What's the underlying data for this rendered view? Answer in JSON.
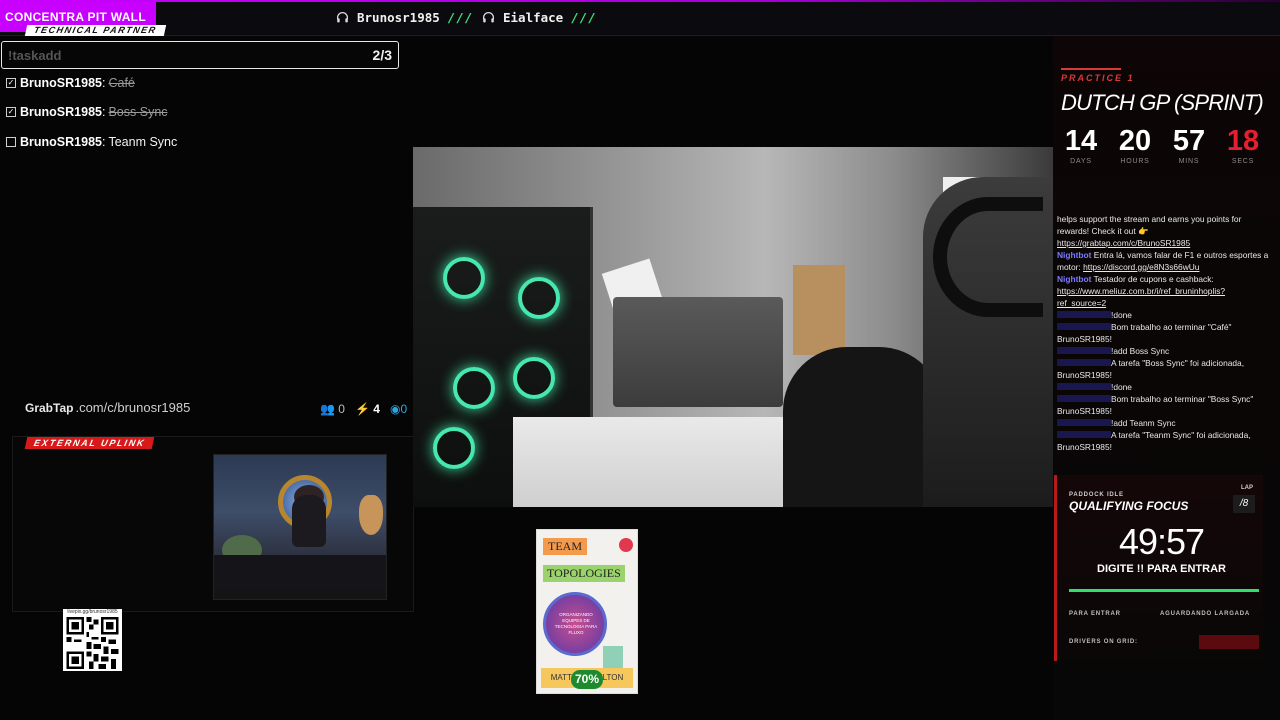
{
  "topbar": {
    "brand": "CONCENTRA PIT WALL",
    "team_1": "Brunosr1985",
    "team_2": "Eialface",
    "divider": "///"
  },
  "tasks": {
    "partner_tag": "TECHNICAL PARTNER",
    "command": "!taskadd",
    "count": "2/3",
    "items": [
      {
        "user": "BrunoSR1985",
        "text": "Café",
        "done": true
      },
      {
        "user": "BrunoSR1985",
        "text": "Boss Sync",
        "done": true
      },
      {
        "user": "BrunoSR1985",
        "text": "Teanm Sync",
        "done": false
      }
    ],
    "separator": ":"
  },
  "grabtap": {
    "logo": "GrabTap",
    "url": ".com/c/brunosr1985",
    "viewers": "0",
    "points": "4",
    "live": "0"
  },
  "uplink": {
    "tag": "EXTERNAL UPLINK"
  },
  "qr": {
    "label": "livepix.gg/brunosr1985"
  },
  "book": {
    "title_1": "TEAM",
    "title_2": "TOPOLOGIES",
    "subtitle": "ORGANIZANDO EQUIPES DE TECNOLOGIA PARA FLUXO",
    "author": "MATTH... SKELTON ...PAIS",
    "progress": "70%"
  },
  "race": {
    "session": "PRACTICE 1",
    "title": "DUTCH GP (SPRINT)",
    "countdown": [
      {
        "value": "14",
        "label": "DAYS"
      },
      {
        "value": "20",
        "label": "HOURS"
      },
      {
        "value": "57",
        "label": "MINS"
      },
      {
        "value": "18",
        "label": "SECS"
      }
    ]
  },
  "chat": [
    {
      "user": "",
      "text": "helps support the stream and earns you points for rewards! Check it out 👉",
      "link": "https://grabtap.com/c/BrunoSR1985"
    },
    {
      "user": "Nightbot",
      "text": "Entra lá, vamos falar de F1 e outros esportes a motor:",
      "link": "https://discord.gg/e8N3s66wUu"
    },
    {
      "user": "Nightbot",
      "text": "Testador de cupons e cashback:",
      "link": "https://www.meliuz.com.br/i/ref_bruninhoplis?ref_source=2"
    },
    {
      "user": "",
      "text": "!done",
      "link": ""
    },
    {
      "user": "",
      "text": "Bom trabalho ao terminar \"Café\" BrunoSR1985!",
      "link": ""
    },
    {
      "user": "",
      "text": "!add Boss Sync",
      "link": ""
    },
    {
      "user": "",
      "text": "A tarefa \"Boss Sync\" foi adicionada, BrunoSR1985!",
      "link": ""
    },
    {
      "user": "",
      "text": "!done",
      "link": ""
    },
    {
      "user": "",
      "text": "Bom trabalho ao terminar \"Boss Sync\" BrunoSR1985!",
      "link": ""
    },
    {
      "user": "",
      "text": "!add Teanm Sync",
      "link": ""
    },
    {
      "user": "",
      "text": "A tarefa \"Teanm Sync\" foi adicionada, BrunoSR1985!",
      "link": ""
    }
  ],
  "colors": {
    "nightbot": "#7b7bff",
    "hidden_user": "#3a3ad8",
    "brand": "#c800ff",
    "accent_red": "#e51f30",
    "accent_green": "#2ee06c"
  },
  "quali": {
    "status": "PADDOCK IDLE",
    "lap_label": "LAP",
    "lap_value": "/8",
    "title": "QUALIFYING FOCUS",
    "time": "49:57",
    "command": "DIGITE !! PARA ENTRAR",
    "enter": "PARA ENTRAR",
    "waiting": "AGUARDANDO LARGADA",
    "drivers": "DRIVERS ON GRID:"
  }
}
